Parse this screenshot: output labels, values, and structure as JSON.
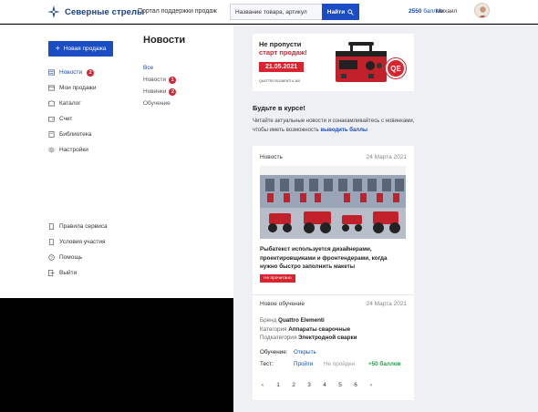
{
  "header": {
    "logo_text": "Северные стрелы",
    "portal_label": "Портал поддержки продаж",
    "search_placeholder": "Название товара, артикул",
    "search_button": "Найти",
    "points_value": "2550",
    "points_unit": "баллов",
    "user_name": "Михаил"
  },
  "sidebar": {
    "new_sale_label": "Новая продажа",
    "items": [
      {
        "label": "Новости",
        "badge": "2",
        "icon": "news-icon"
      },
      {
        "label": "Мои продажи",
        "badge": "",
        "icon": "sales-icon"
      },
      {
        "label": "Каталог",
        "badge": "",
        "icon": "catalog-icon"
      },
      {
        "label": "Счет",
        "badge": "",
        "icon": "wallet-icon"
      },
      {
        "label": "Библиотека",
        "badge": "",
        "icon": "library-icon"
      },
      {
        "label": "Настройки",
        "badge": "",
        "icon": "settings-icon"
      }
    ],
    "bottom_items": [
      {
        "label": "Правила сервиса",
        "icon": "doc-icon"
      },
      {
        "label": "Условия участия",
        "icon": "doc-icon"
      },
      {
        "label": "Помощь",
        "icon": "help-icon"
      },
      {
        "label": "Выйти",
        "icon": "exit-icon"
      }
    ]
  },
  "news": {
    "title": "Новости",
    "filters": [
      {
        "label": "Все",
        "badge": ""
      },
      {
        "label": "Новости",
        "badge": "1"
      },
      {
        "label": "Новинки",
        "badge": "2"
      },
      {
        "label": "Обучение",
        "badge": ""
      }
    ]
  },
  "banner": {
    "line1": "Не пропусти",
    "line2": "старт продаж!",
    "date": "21.05.2021",
    "brand": "QUATTRO ELEMENTI A 160",
    "logo_text": "QE"
  },
  "stay": {
    "title": "Будьте в курсе!",
    "text": "Читайте актуальные новости и ознакамливайтесь с новинками, чтобы иметь возможность",
    "link": "выводить баллы"
  },
  "card1": {
    "category": "Новость",
    "date": "24 Марта 2021",
    "text": "Рыбатекст используется дизайнерами, проектировщиками и фронтендерами, когда нужно быстро заполнить макеты",
    "unread_label": "Не прочитано"
  },
  "card2": {
    "category": "Новое обучение",
    "date": "24 Марта 2021",
    "brand_label": "Бренд",
    "brand_value": "Quattro Elementi",
    "category_label": "Категория",
    "category_value": "Аппараты сварочные",
    "subcategory_label": "Подкатегория",
    "subcategory_value": "Электродной сварки",
    "training_label": "Обучение:",
    "training_action": "Открыть",
    "test_label": "Тест:",
    "test_action": "Пройти",
    "test_status": "Не пройден",
    "test_points": "+50 баллов"
  },
  "pagination": {
    "prev": "‹",
    "pages": [
      "1",
      "2",
      "3",
      "4",
      "5",
      "6"
    ],
    "next": "›"
  },
  "colors": {
    "accent": "#1a4cc4",
    "red": "#d9232e",
    "green": "#1f9e4a"
  }
}
